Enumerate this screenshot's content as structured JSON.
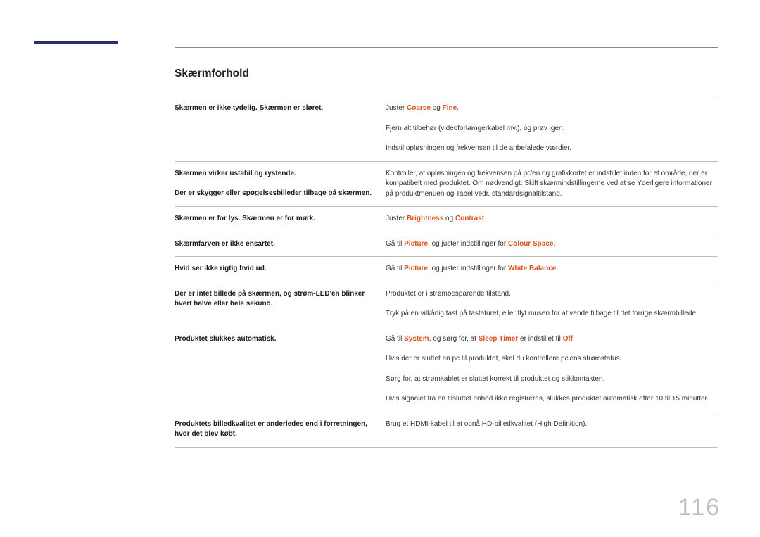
{
  "page": {
    "heading": "Skærmforhold",
    "number": "116"
  },
  "rows": [
    {
      "left": "Skærmen er ikke tydelig. Skærmen er sløret.",
      "right": [
        [
          {
            "t": "Juster "
          },
          {
            "t": "Coarse",
            "hl": true
          },
          {
            "t": " og "
          },
          {
            "t": "Fine",
            "hl": true
          },
          {
            "t": "."
          }
        ],
        [
          {
            "t": "Fjern alt tilbehør (videoforlængerkabel mv.), og prøv igen."
          }
        ],
        [
          {
            "t": "Indstil opløsningen og frekvensen til de anbefalede værdier."
          }
        ]
      ]
    },
    {
      "left": "Skærmen virker ustabil og rystende.\n\nDer er skygger eller spøgelsesbilleder tilbage på skærmen.",
      "right": [
        [
          {
            "t": "Kontroller, at opløsningen og frekvensen på pc'en og grafikkortet er indstillet inden for et område, der er kompatibelt med produktet. Om nødvendigt: Skift skærmindstillingerne ved at se Yderligere informationer på produktmenuen og Tabel vedr. standardsignaltilstand."
          }
        ]
      ]
    },
    {
      "left": "Skærmen er for lys. Skærmen er for mørk.",
      "right": [
        [
          {
            "t": "Juster "
          },
          {
            "t": "Brightness",
            "hl": true
          },
          {
            "t": " og "
          },
          {
            "t": "Contrast",
            "hl": true
          },
          {
            "t": "."
          }
        ]
      ]
    },
    {
      "left": "Skærmfarven er ikke ensartet.",
      "right": [
        [
          {
            "t": "Gå til "
          },
          {
            "t": "Picture",
            "hl": true
          },
          {
            "t": ", og juster indstillinger for "
          },
          {
            "t": "Colour Space",
            "hl": true
          },
          {
            "t": "."
          }
        ]
      ]
    },
    {
      "left": "Hvid ser ikke rigtig hvid ud.",
      "right": [
        [
          {
            "t": "Gå til "
          },
          {
            "t": "Picture",
            "hl": true
          },
          {
            "t": ", og juster indstillinger for "
          },
          {
            "t": "White Balance",
            "hl": true
          },
          {
            "t": "."
          }
        ]
      ]
    },
    {
      "left": "Der er intet billede på skærmen, og strøm-LED'en blinker hvert halve eller hele sekund.",
      "right": [
        [
          {
            "t": "Produktet er i strømbesparende tilstand."
          }
        ],
        [
          {
            "t": "Tryk på en vilkårlig tast på tastaturet, eller flyt musen for at vende tilbage til det forrige skærmbillede."
          }
        ]
      ]
    },
    {
      "left": "Produktet slukkes automatisk.",
      "right": [
        [
          {
            "t": "Gå til "
          },
          {
            "t": "System",
            "hl": true
          },
          {
            "t": ", og sørg for, at "
          },
          {
            "t": "Sleep Timer",
            "hl": true
          },
          {
            "t": " er indstillet til "
          },
          {
            "t": "Off",
            "hl": true
          },
          {
            "t": "."
          }
        ],
        [
          {
            "t": "Hvis der er sluttet en pc til produktet, skal du kontrollere pc'ens strømstatus."
          }
        ],
        [
          {
            "t": "Sørg for, at strømkablet er sluttet korrekt til produktet og stikkontakten."
          }
        ],
        [
          {
            "t": "Hvis signalet fra en tilsluttet enhed ikke registreres, slukkes produktet automatisk efter 10 til 15 minutter."
          }
        ]
      ]
    },
    {
      "left": "Produktets billedkvalitet er anderledes end i forretningen, hvor det blev købt.",
      "right": [
        [
          {
            "t": "Brug et HDMI-kabel til at opnå HD-billedkvalitet (High Definition)."
          }
        ]
      ]
    }
  ]
}
